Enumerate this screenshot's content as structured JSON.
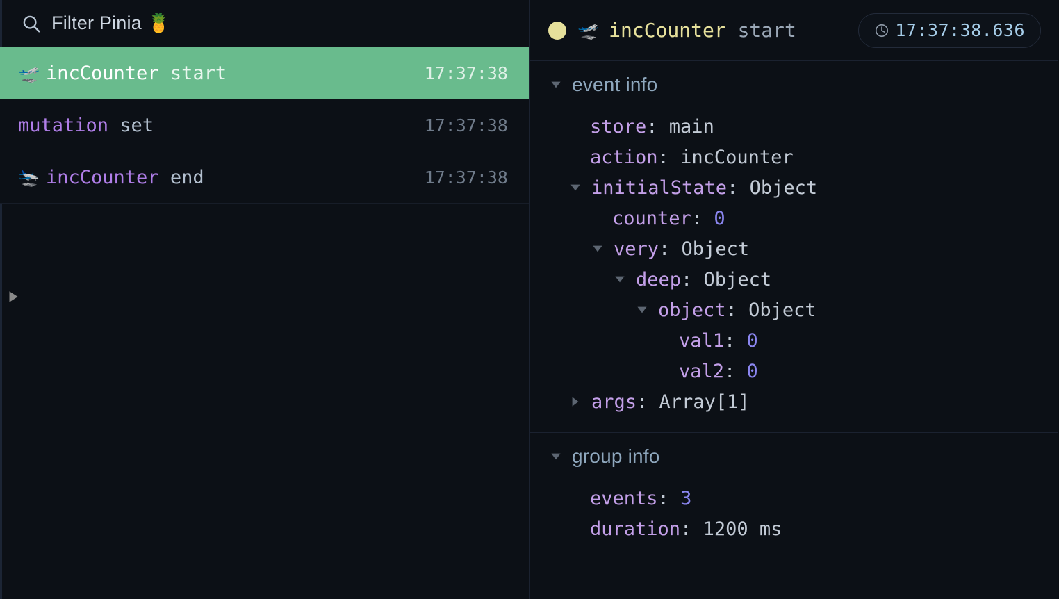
{
  "colors": {
    "background": "#0c1016",
    "selected_row": "#69bb8d",
    "accent_purple": "#b07ee8",
    "accent_key": "#c39fe8",
    "accent_number": "#8b86f0",
    "status_dot": "#e6e09b",
    "timestamp_blue": "#a6cde9",
    "section_title": "#8ea7bd",
    "divider": "#1b2230"
  },
  "sidebar": {
    "search": {
      "icon": "search-icon",
      "placeholder": "Filter Pinia 🍍",
      "value": ""
    },
    "expander_icon": "triangle-right-icon",
    "events": [
      {
        "emoji": "🛫",
        "emoji_name": "airplane-departure-icon",
        "name": "incCounter",
        "kind": " start",
        "time": "17:37:38",
        "selected": true
      },
      {
        "emoji": "",
        "emoji_name": "none",
        "name": "mutation",
        "kind": " set",
        "time": "17:37:38",
        "selected": false
      },
      {
        "emoji": "🛬",
        "emoji_name": "airplane-arrival-icon",
        "name": "incCounter",
        "kind": " end",
        "time": "17:37:38",
        "selected": false
      }
    ]
  },
  "detail": {
    "header": {
      "dot": "status-dot-yellow",
      "emoji": "🛫",
      "emoji_name": "airplane-departure-icon",
      "name": "incCounter",
      "kind": " start",
      "clock_icon": "clock-icon",
      "timestamp": "17:37:38.636"
    },
    "sections": [
      {
        "title": "event info",
        "expanded": true,
        "rows": [
          {
            "indent": 1,
            "caret": "none",
            "key": "store",
            "sep": ": ",
            "value": "main",
            "value_type": "string"
          },
          {
            "indent": 1,
            "caret": "none",
            "key": "action",
            "sep": ": ",
            "value": "incCounter",
            "value_type": "string"
          },
          {
            "indent": 1,
            "caret": "expanded",
            "key": "initialState",
            "sep": ": ",
            "value": "Object",
            "value_type": "object"
          },
          {
            "indent": 2,
            "caret": "none",
            "key": "counter",
            "sep": ": ",
            "value": "0",
            "value_type": "number"
          },
          {
            "indent": 2,
            "caret": "expanded",
            "key": "very",
            "sep": ": ",
            "value": "Object",
            "value_type": "object"
          },
          {
            "indent": 3,
            "caret": "expanded",
            "key": "deep",
            "sep": ": ",
            "value": "Object",
            "value_type": "object"
          },
          {
            "indent": 4,
            "caret": "expanded",
            "key": "object",
            "sep": ": ",
            "value": "Object",
            "value_type": "object"
          },
          {
            "indent": 5,
            "caret": "none",
            "key": "val1",
            "sep": ": ",
            "value": "0",
            "value_type": "number"
          },
          {
            "indent": 5,
            "caret": "none",
            "key": "val2",
            "sep": ": ",
            "value": "0",
            "value_type": "number"
          },
          {
            "indent": 1,
            "caret": "collapsed",
            "key": "args",
            "sep": ": ",
            "value": "Array[1]",
            "value_type": "array"
          }
        ]
      },
      {
        "title": "group info",
        "expanded": true,
        "rows": [
          {
            "indent": 1,
            "caret": "none",
            "key": "events",
            "sep": ": ",
            "value": "3",
            "value_type": "number"
          },
          {
            "indent": 1,
            "caret": "none",
            "key": "duration",
            "sep": ": ",
            "value": "1200 ms",
            "value_type": "string"
          }
        ]
      }
    ]
  }
}
